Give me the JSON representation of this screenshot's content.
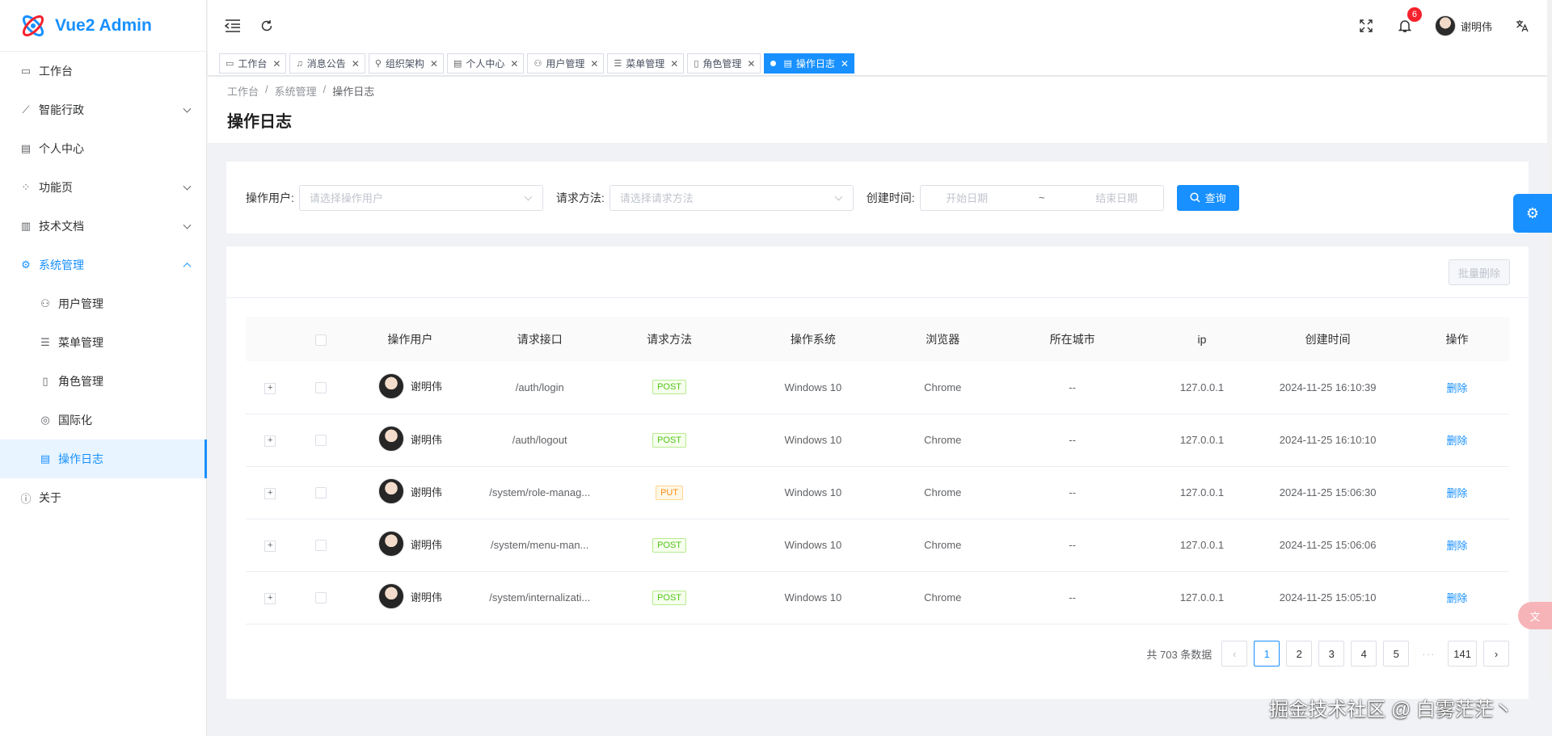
{
  "app": {
    "title": "Vue2 Admin"
  },
  "sidebar": {
    "items": [
      {
        "label": "工作台",
        "icon": "dashboard-icon"
      },
      {
        "label": "智能行政",
        "icon": "leaf-icon"
      },
      {
        "label": "个人中心",
        "icon": "id-card-icon"
      },
      {
        "label": "功能页",
        "icon": "apps-icon"
      },
      {
        "label": "技术文档",
        "icon": "doc-icon"
      },
      {
        "label": "系统管理",
        "icon": "gear-icon"
      },
      {
        "label": "用户管理",
        "icon": "user-icon"
      },
      {
        "label": "菜单管理",
        "icon": "menu-icon"
      },
      {
        "label": "角色管理",
        "icon": "role-icon"
      },
      {
        "label": "国际化",
        "icon": "globe-icon"
      },
      {
        "label": "操作日志",
        "icon": "log-icon"
      },
      {
        "label": "关于",
        "icon": "info-icon"
      }
    ]
  },
  "header": {
    "notification_count": "6",
    "user_name": "谢明伟"
  },
  "tabs": [
    {
      "label": "工作台"
    },
    {
      "label": "消息公告"
    },
    {
      "label": "组织架构"
    },
    {
      "label": "个人中心"
    },
    {
      "label": "用户管理"
    },
    {
      "label": "菜单管理"
    },
    {
      "label": "角色管理"
    },
    {
      "label": "操作日志"
    }
  ],
  "breadcrumb": {
    "home": "工作台",
    "parent": "系统管理",
    "current": "操作日志"
  },
  "page": {
    "title": "操作日志"
  },
  "search": {
    "user_label": "操作用户:",
    "user_placeholder": "请选择操作用户",
    "method_label": "请求方法:",
    "method_placeholder": "请选择请求方法",
    "time_label": "创建时间:",
    "start_placeholder": "开始日期",
    "range_sep": "~",
    "end_placeholder": "结束日期",
    "submit": "查询"
  },
  "toolbar": {
    "batch_delete": "批量删除"
  },
  "table": {
    "headers": [
      "操作用户",
      "请求接口",
      "请求方法",
      "操作系统",
      "浏览器",
      "所在城市",
      "ip",
      "创建时间",
      "操作"
    ],
    "rows": [
      {
        "user": "谢明伟",
        "api": "/auth/login",
        "method": "POST",
        "os": "Windows 10",
        "browser": "Chrome",
        "city": "--",
        "ip": "127.0.0.1",
        "time": "2024-11-25 16:10:39",
        "action": "删除"
      },
      {
        "user": "谢明伟",
        "api": "/auth/logout",
        "method": "POST",
        "os": "Windows 10",
        "browser": "Chrome",
        "city": "--",
        "ip": "127.0.0.1",
        "time": "2024-11-25 16:10:10",
        "action": "删除"
      },
      {
        "user": "谢明伟",
        "api": "/system/role-manag...",
        "method": "PUT",
        "os": "Windows 10",
        "browser": "Chrome",
        "city": "--",
        "ip": "127.0.0.1",
        "time": "2024-11-25 15:06:30",
        "action": "删除"
      },
      {
        "user": "谢明伟",
        "api": "/system/menu-man...",
        "method": "POST",
        "os": "Windows 10",
        "browser": "Chrome",
        "city": "--",
        "ip": "127.0.0.1",
        "time": "2024-11-25 15:06:06",
        "action": "删除"
      },
      {
        "user": "谢明伟",
        "api": "/system/internalizati...",
        "method": "POST",
        "os": "Windows 10",
        "browser": "Chrome",
        "city": "--",
        "ip": "127.0.0.1",
        "time": "2024-11-25 15:05:10",
        "action": "删除"
      }
    ]
  },
  "pagination": {
    "total_text": "共 703 条数据",
    "pages": [
      "1",
      "2",
      "3",
      "4",
      "5"
    ],
    "more": "···",
    "last": "141",
    "current": "1"
  },
  "watermark": "掘金技术社区 @ 白雾茫茫丶",
  "colors": {
    "primary": "#1890ff",
    "post": "#52c41a",
    "put": "#fa8c16",
    "badge": "#f5222d"
  }
}
